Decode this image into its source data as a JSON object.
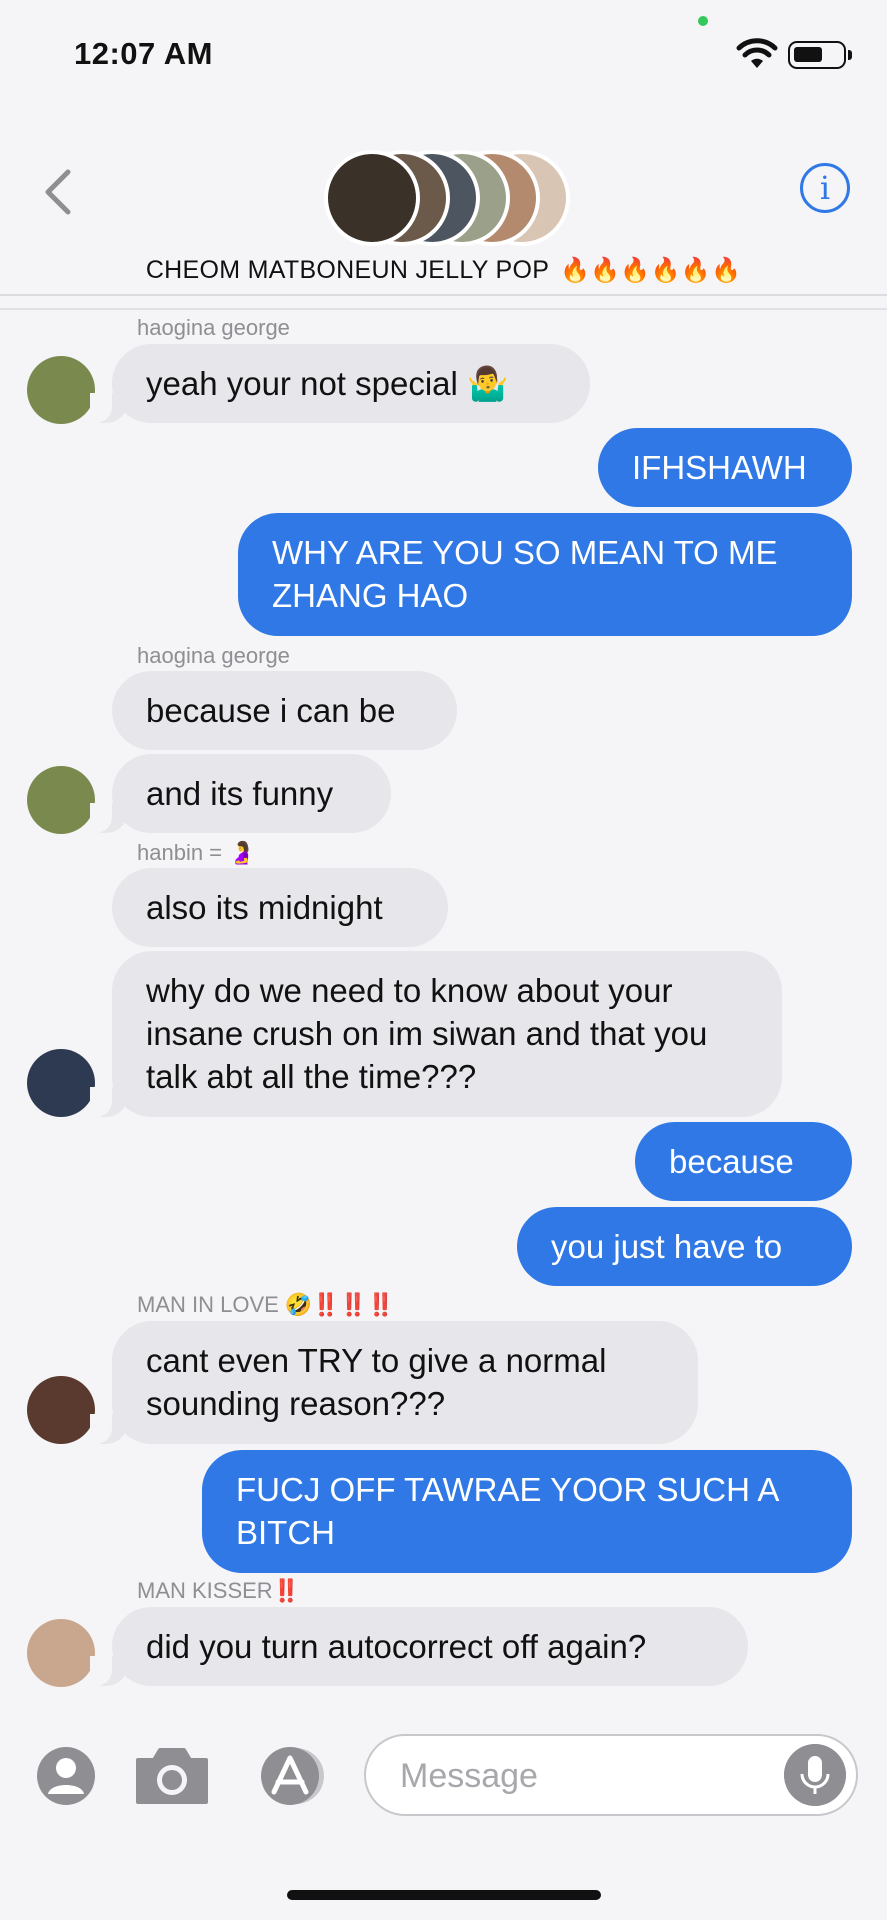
{
  "status_bar": {
    "time": "12:07 AM",
    "battery_fraction": 0.6
  },
  "header": {
    "back_icon": "chevron-left-icon",
    "info_icon": "info-icon",
    "info_label": "i",
    "group_name": "CHEOM MATBONEUN JELLY POP",
    "title_emojis": "🔥🔥🔥🔥🔥🔥",
    "member_avatar_colors": [
      "#3a3228",
      "#6b5a4a",
      "#4c5560",
      "#9aa08a",
      "#b48a6e",
      "#d9c5b3"
    ]
  },
  "messages": {
    "sender_1": "haogina george",
    "m1": "yeah your not special 🤷‍♂️",
    "m2": "IFHSHAWH",
    "m3": "WHY ARE YOU SO MEAN TO ME ZHANG HAO",
    "sender_2": "haogina george",
    "m4": "because i can be",
    "m5": "and its funny",
    "sender_3_name": "hanbin = ",
    "sender_3_emoji": "🤰",
    "m6": "also its midnight",
    "m7": "why do we need to know about your insane crush on im siwan and that you talk abt all the time???",
    "m8": "because",
    "m9": "you just have to",
    "sender_4_name": "MAN IN LOVE ",
    "sender_4_emoji": "🤣",
    "sender_4_marks": "‼️‼️‼️",
    "m10": "cant even TRY to give a normal sounding reason???",
    "m11": "FUCJ OFF TAWRAE YOOR SUCH A BITCH",
    "sender_5_name": "MAN KISSER",
    "sender_5_marks": "‼️",
    "m12": "did you turn autocorrect off again?"
  },
  "input_bar": {
    "placeholder": "Message",
    "icons": [
      "contact-icon",
      "camera-icon",
      "app-store-icon",
      "microphone-icon"
    ]
  },
  "colors": {
    "accent": "#2f78e6",
    "incoming": "#e6e6eb",
    "background": "#f5f5f7"
  }
}
